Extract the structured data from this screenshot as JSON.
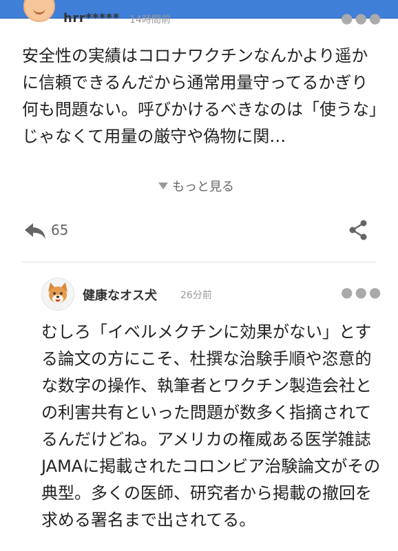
{
  "comment1": {
    "username": "hrr*****",
    "time": "14時間前",
    "text": "安全性の実績はコロナワクチンなんかより遥かに信頼できるんだから通常用量守ってるかぎり何も問題ない。呼びかけるべきなのは「使うな」じゃなくて用量の厳守や偽物に関…",
    "more_label": "もっと見る",
    "reply_count": "65"
  },
  "comment2": {
    "username": "健康なオス犬",
    "time": "26分前",
    "text": "むしろ「イベルメクチンに効果がない」とする論文の方にこそ、杜撰な治験手順や恣意的な数字の操作、執筆者とワクチン製造会社との利害共有といった問題が数多く指摘されてるんだけどね。アメリカの権威ある医学雑誌JAMAに掲載されたコロンビア治験論文がその典型。多くの医師、研究者から掲載の撤回を求める署名まで出されてる。"
  },
  "icons": {
    "reply": "reply-arrow-icon",
    "share": "share-icon",
    "more_options": "more-dots-icon",
    "expand": "triangle-down-icon"
  },
  "colors": {
    "topbar": "#3f7fd8",
    "icon_gray": "#666666"
  }
}
